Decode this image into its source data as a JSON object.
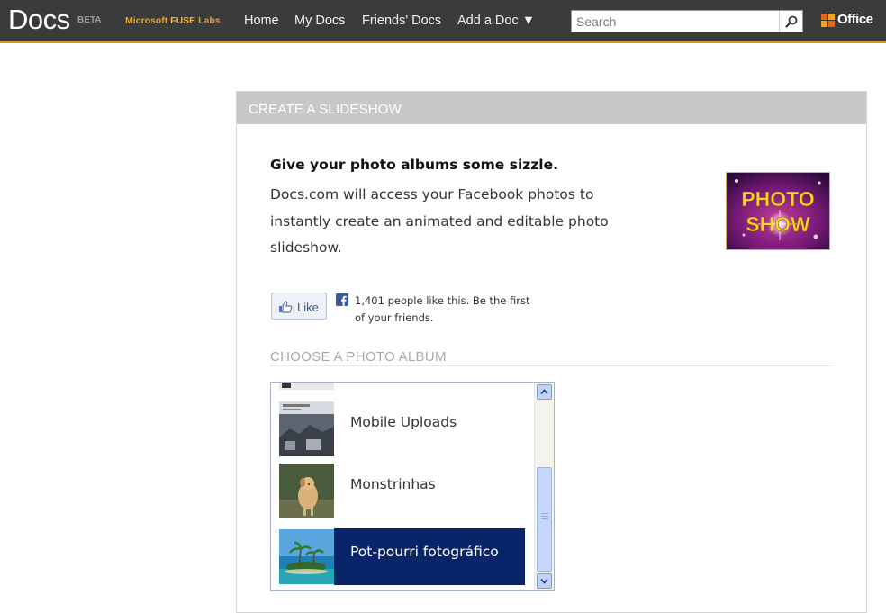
{
  "header": {
    "logo": "Docs",
    "beta": "BETA",
    "fuse_prefix": "Microsoft",
    "fuse_bold": "FUSE",
    "fuse_suffix": "Labs",
    "nav": [
      "Home",
      "My Docs",
      "Friends' Docs",
      "Add a Doc ▼"
    ],
    "search_placeholder": "Search",
    "office": "Office",
    "accent_color": "#d79a1e",
    "bg_color": "#3b3b3b"
  },
  "panel": {
    "title": "CREATE A SLIDESHOW",
    "headline": "Give your photo albums some sizzle.",
    "description": "Docs.com will access your Facebook photos to instantly create an animated and editable photo slideshow.",
    "badge_line1": "PHOTO",
    "badge_line2": "SHOW",
    "like_label": "Like",
    "like_text": "1,401 people like this. Be the first of your friends.",
    "choose_title": "CHOOSE A PHOTO ALBUM"
  },
  "albums": [
    {
      "name": "Mobile Uploads",
      "selected": false
    },
    {
      "name": "Monstrinhas",
      "selected": false
    },
    {
      "name": "Pot-pourri fotográfico",
      "selected": true
    }
  ],
  "colors": {
    "selection": "#0a246a",
    "panel_header": "#c8c8c8",
    "facebook_blue": "#3b5998"
  }
}
